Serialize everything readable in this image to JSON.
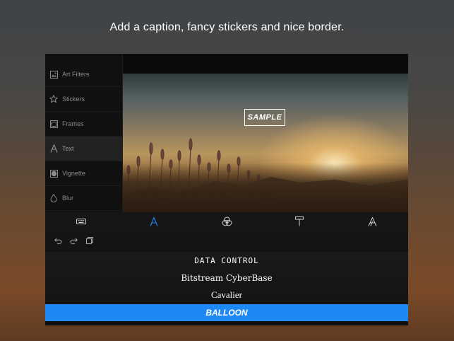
{
  "headline": "Add a caption, fancy stickers and nice border.",
  "sidebar": {
    "items": [
      {
        "label": "Art Filters",
        "icon": "image-icon"
      },
      {
        "label": "Stickers",
        "icon": "star-icon"
      },
      {
        "label": "Frames",
        "icon": "frame-icon"
      },
      {
        "label": "Text",
        "icon": "text-icon",
        "active": true
      },
      {
        "label": "Vignette",
        "icon": "vignette-icon"
      },
      {
        "label": "Blur",
        "icon": "drop-icon"
      }
    ]
  },
  "preview": {
    "sample_text": "SAMPLE"
  },
  "toolbar": {
    "tools": [
      "keyboard-icon",
      "font-icon",
      "color-icon",
      "paint-roller-icon",
      "outline-font-icon"
    ],
    "active_tool": "font-icon",
    "accent_color": "#1e88f5"
  },
  "actions": [
    "undo-icon",
    "redo-icon",
    "copy-icon"
  ],
  "fonts": {
    "items": [
      "DATA CONTROL",
      "Bitstream CyberBase",
      "Cavalier",
      "BALLOON"
    ],
    "selected": "BALLOON"
  }
}
